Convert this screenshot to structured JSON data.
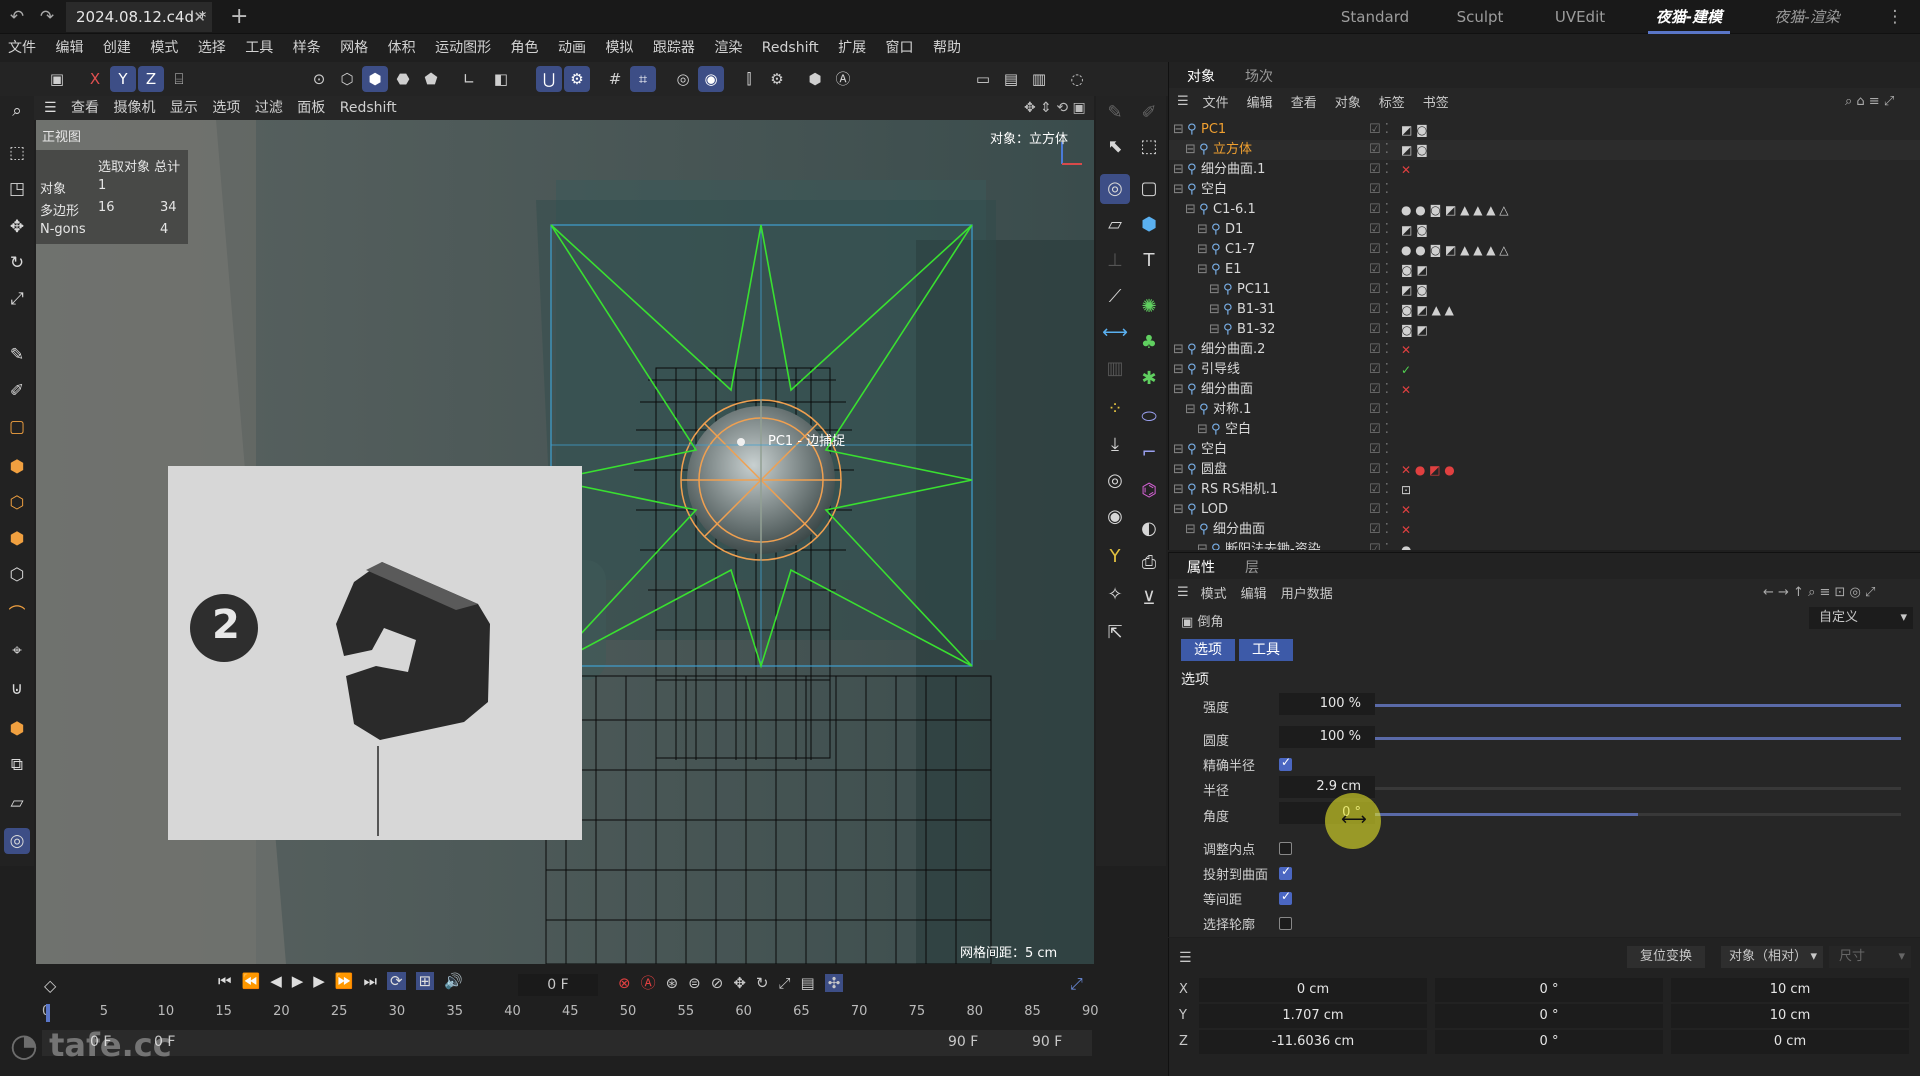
{
  "title_bar": {
    "doc_tab": "2024.08.12.c4d *",
    "layouts": [
      "Standard",
      "Sculpt",
      "UVEdit",
      "夜猫-建模",
      "夜猫-渲染"
    ],
    "active_layout": "夜猫-建模"
  },
  "menu": [
    "文件",
    "编辑",
    "创建",
    "模式",
    "选择",
    "工具",
    "样条",
    "网格",
    "体积",
    "运动图形",
    "角色",
    "动画",
    "模拟",
    "跟踪器",
    "渲染",
    "Redshift",
    "扩展",
    "窗口",
    "帮助"
  ],
  "axis_buttons": [
    "X",
    "Y",
    "Z"
  ],
  "viewport": {
    "menu": [
      "查看",
      "摄像机",
      "显示",
      "选项",
      "过滤",
      "面板",
      "Redshift"
    ],
    "view_name": "正视图",
    "info_header": "选取对象 总计",
    "info_rows": [
      {
        "label": "对象",
        "selected": "1",
        "total": ""
      },
      {
        "label": "多边形",
        "selected": "16",
        "total": "34"
      },
      {
        "label": "N-gons",
        "selected": "",
        "total": "4"
      }
    ],
    "object_label": "对象：立方体",
    "snap_label": "PC1 - 边捕捉",
    "grid_spacing": "网格间距：5 cm",
    "ref_number": "2"
  },
  "object_manager": {
    "tabs": [
      "对象",
      "场次"
    ],
    "menu": [
      "文件",
      "编辑",
      "查看",
      "对象",
      "标签",
      "书签"
    ],
    "rows": [
      {
        "name": "PC1",
        "depth": 0,
        "color": "#f0a030",
        "tags": "◩ ◙"
      },
      {
        "name": "立方体",
        "depth": 1,
        "color": "#f0a030",
        "tags": "◩ ◙"
      },
      {
        "name": "细分曲面.1",
        "depth": 0,
        "color": "#d9d9d9",
        "tags": "✕"
      },
      {
        "name": "空白",
        "depth": 0,
        "color": "#d9d9d9",
        "tags": ""
      },
      {
        "name": "C1-6.1",
        "depth": 1,
        "color": "#d9d9d9",
        "tags": "● ● ◙ ◩ ▲ ▲ ▲ △"
      },
      {
        "name": "D1",
        "depth": 2,
        "color": "#d9d9d9",
        "tags": "◩ ◙"
      },
      {
        "name": "C1-7",
        "depth": 2,
        "color": "#d9d9d9",
        "tags": "● ● ◙ ◩ ▲ ▲ ▲ △"
      },
      {
        "name": "E1",
        "depth": 2,
        "color": "#d9d9d9",
        "tags": "◙ ◩"
      },
      {
        "name": "PC11",
        "depth": 3,
        "color": "#d9d9d9",
        "tags": "◩ ◙"
      },
      {
        "name": "B1-31",
        "depth": 3,
        "color": "#d9d9d9",
        "tags": "◙ ◩ ▲ ▲"
      },
      {
        "name": "B1-32",
        "depth": 3,
        "color": "#d9d9d9",
        "tags": "◙ ◩"
      },
      {
        "name": "细分曲面.2",
        "depth": 0,
        "color": "#d9d9d9",
        "tags": "✕"
      },
      {
        "name": "引导线",
        "depth": 0,
        "color": "#d9d9d9",
        "tags": "✓"
      },
      {
        "name": "细分曲面",
        "depth": 0,
        "color": "#d9d9d9",
        "tags": "✕"
      },
      {
        "name": "对称.1",
        "depth": 1,
        "color": "#d9d9d9",
        "tags": ""
      },
      {
        "name": "空白",
        "depth": 2,
        "color": "#d9d9d9",
        "tags": ""
      },
      {
        "name": "空白",
        "depth": 0,
        "color": "#d9d9d9",
        "tags": ""
      },
      {
        "name": "圆盘",
        "depth": 0,
        "color": "#d9d9d9",
        "tags": "✕ ● ◩ ●"
      },
      {
        "name": "RS RS相机.1",
        "depth": 0,
        "color": "#d9d9d9",
        "tags": "⊡"
      },
      {
        "name": "LOD",
        "depth": 0,
        "color": "#d9d9d9",
        "tags": "✕"
      },
      {
        "name": "细分曲面",
        "depth": 1,
        "color": "#d9d9d9",
        "tags": "✕"
      },
      {
        "name": "断阳法去锄-资染",
        "depth": 2,
        "color": "#d9d9d9",
        "tags": "●"
      }
    ]
  },
  "attributes": {
    "tabs": [
      "属性",
      "层"
    ],
    "menu": [
      "模式",
      "编辑",
      "用户数据"
    ],
    "tool_name": "倒角",
    "custom_label": "自定义",
    "subtabs": [
      "选项",
      "工具"
    ],
    "section": "选项",
    "fields": [
      {
        "label": "强度",
        "value": "100 %",
        "fill": 1.0
      },
      {
        "label": "圆度",
        "value": "100 %",
        "fill": 1.0
      },
      {
        "label": "精确半径",
        "checkbox": true
      },
      {
        "label": "半径",
        "value": "2.9 cm",
        "fill": 0.0
      },
      {
        "label": "角度",
        "value": "0 °",
        "fill": 0.5
      }
    ],
    "checks": [
      {
        "label": "调整内点",
        "checked": false
      },
      {
        "label": "投射到曲面",
        "checked": true
      },
      {
        "label": "等间距",
        "checked": true
      },
      {
        "label": "选择轮廓",
        "checked": false
      }
    ]
  },
  "coordinates": {
    "reset_button": "复位变换",
    "mode": "对象（相对）",
    "size_label": "尺寸",
    "rows": [
      {
        "axis": "X",
        "pos": "0 cm",
        "rot": "0 °",
        "size": "10 cm"
      },
      {
        "axis": "Y",
        "pos": "1.707 cm",
        "rot": "0 °",
        "size": "10 cm"
      },
      {
        "axis": "Z",
        "pos": "-11.6036 cm",
        "rot": "0 °",
        "size": "0 cm"
      }
    ]
  },
  "timeline": {
    "current_frame": "0 F",
    "start_frame": "0 F",
    "start_field": "0 F",
    "end_frame": "90 F",
    "end_field": "90 F",
    "ticks": [
      "0",
      "5",
      "10",
      "15",
      "20",
      "25",
      "30",
      "35",
      "40",
      "45",
      "50",
      "55",
      "60",
      "65",
      "70",
      "75",
      "80",
      "85",
      "90"
    ]
  },
  "watermark": "tafe.cc"
}
